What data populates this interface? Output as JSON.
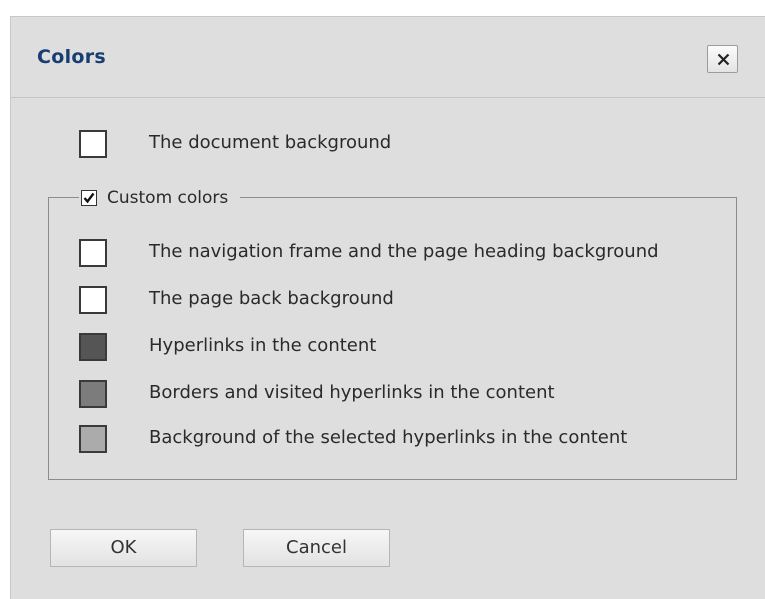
{
  "dialog": {
    "title": "Colors"
  },
  "document_background": {
    "label": "The document background",
    "color": "#ffffff"
  },
  "custom_colors": {
    "label": "Custom colors",
    "checked": true,
    "items": [
      {
        "label": "The navigation frame and the page heading background",
        "color": "#ffffff"
      },
      {
        "label": "The page back background",
        "color": "#ffffff"
      },
      {
        "label": "Hyperlinks in the content",
        "color": "#555555"
      },
      {
        "label": "Borders and visited hyperlinks in the content",
        "color": "#7c7c7c"
      },
      {
        "label": "Background of the selected hyperlinks in the content",
        "color": "#ababab"
      }
    ]
  },
  "buttons": {
    "ok": "OK",
    "cancel": "Cancel"
  }
}
